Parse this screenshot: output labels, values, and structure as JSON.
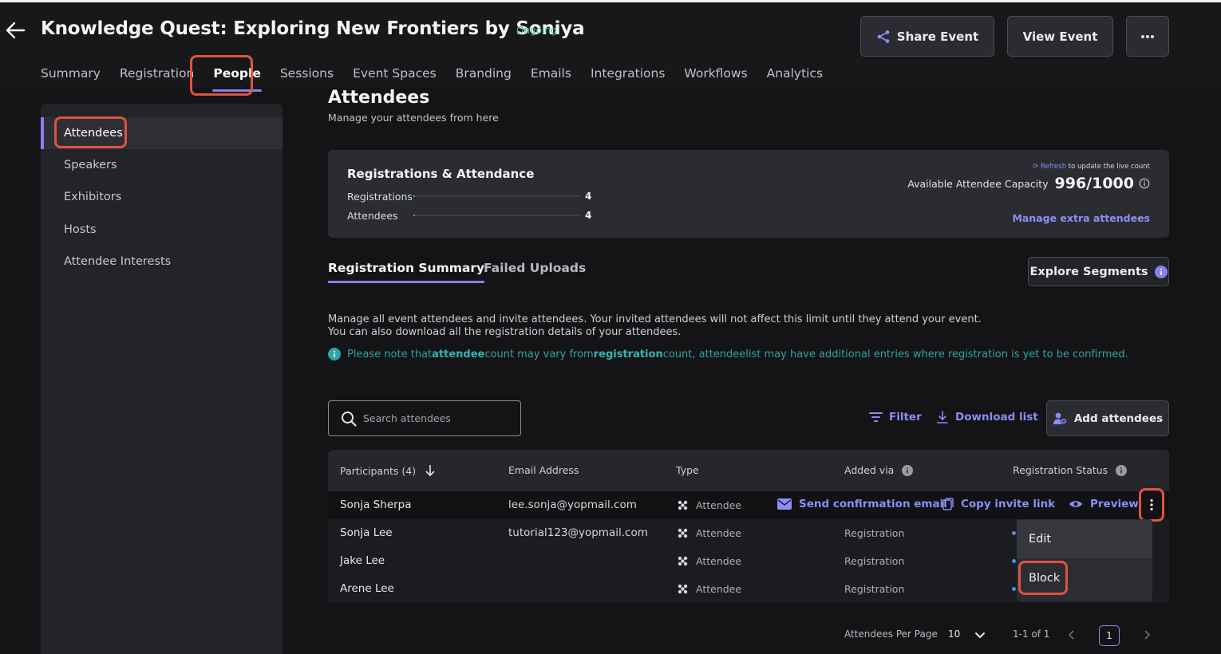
{
  "event": {
    "title": "Knowledge Quest: Exploring New Frontiers by Soniya",
    "status": "Ongoing"
  },
  "header_buttons": {
    "share": "Share Event",
    "view": "View Event"
  },
  "nav_tabs": [
    "Summary",
    "Registration",
    "People",
    "Sessions",
    "Event Spaces",
    "Branding",
    "Emails",
    "Integrations",
    "Workflows",
    "Analytics"
  ],
  "sidebar": {
    "items": [
      "Attendees",
      "Speakers",
      "Exhibitors",
      "Hosts",
      "Attendee Interests"
    ]
  },
  "page": {
    "title": "Attendees",
    "subtitle": "Manage your attendees from here"
  },
  "stats": {
    "title": "Registrations & Attendance",
    "registrations_label": "Registrations",
    "registrations_value": "4",
    "attendees_label": "Attendees",
    "attendees_value": "4",
    "refresh_link": "Refresh",
    "refresh_text": " to update the live count",
    "capacity_label": "Available Attendee Capacity",
    "capacity_value": "996/1000",
    "manage_link": "Manage extra attendees"
  },
  "section_tabs": {
    "summary": "Registration Summary",
    "failed": "Failed Uploads",
    "explore": "Explore Segments"
  },
  "description": {
    "line1": "Manage all event attendees and invite attendees. Your invited attendees will not affect this limit until they attend your event.",
    "line2": "You can also download all the registration details of your attendees.",
    "note_1": "Please note that ",
    "note_2": "attendee",
    "note_3": " count may vary from ",
    "note_4": "registration",
    "note_5": " count, attendeelist may have additional entries where registration is yet to be confirmed."
  },
  "toolbar": {
    "search_placeholder": "Search attendees",
    "filter": "Filter",
    "download": "Download list",
    "add": "Add attendees"
  },
  "table": {
    "headers": {
      "participants": "Participants (4)",
      "email": "Email Address",
      "type": "Type",
      "added_via": "Added via",
      "status": "Registration Status"
    },
    "rows": [
      {
        "name": "Sonja Sherpa",
        "email": "lee.sonja@yopmail.com",
        "type": "Attendee",
        "added_via": ""
      },
      {
        "name": "Sonja Lee",
        "email": "tutorial123@yopmail.com",
        "type": "Attendee",
        "added_via": "Registration"
      },
      {
        "name": "Jake Lee",
        "email": "",
        "type": "Attendee",
        "added_via": "Registration"
      },
      {
        "name": "Arene Lee",
        "email": "",
        "type": "Attendee",
        "added_via": "Registration"
      }
    ],
    "row_actions": {
      "send": "Send confirmation email",
      "copy": "Copy invite link",
      "preview": "Preview"
    }
  },
  "context_menu": {
    "items": [
      "Edit",
      "Block"
    ]
  },
  "pagination": {
    "per_page_label": "Attendees Per Page",
    "per_page": "10",
    "range": "1-1 of 1",
    "current_page": "1"
  },
  "colors": {
    "accent": "#8a7ff0",
    "link": "#8a8ef8",
    "highlight": "#e0533e",
    "status_green": "#3fb68b",
    "note_teal": "#2ea3a3"
  }
}
